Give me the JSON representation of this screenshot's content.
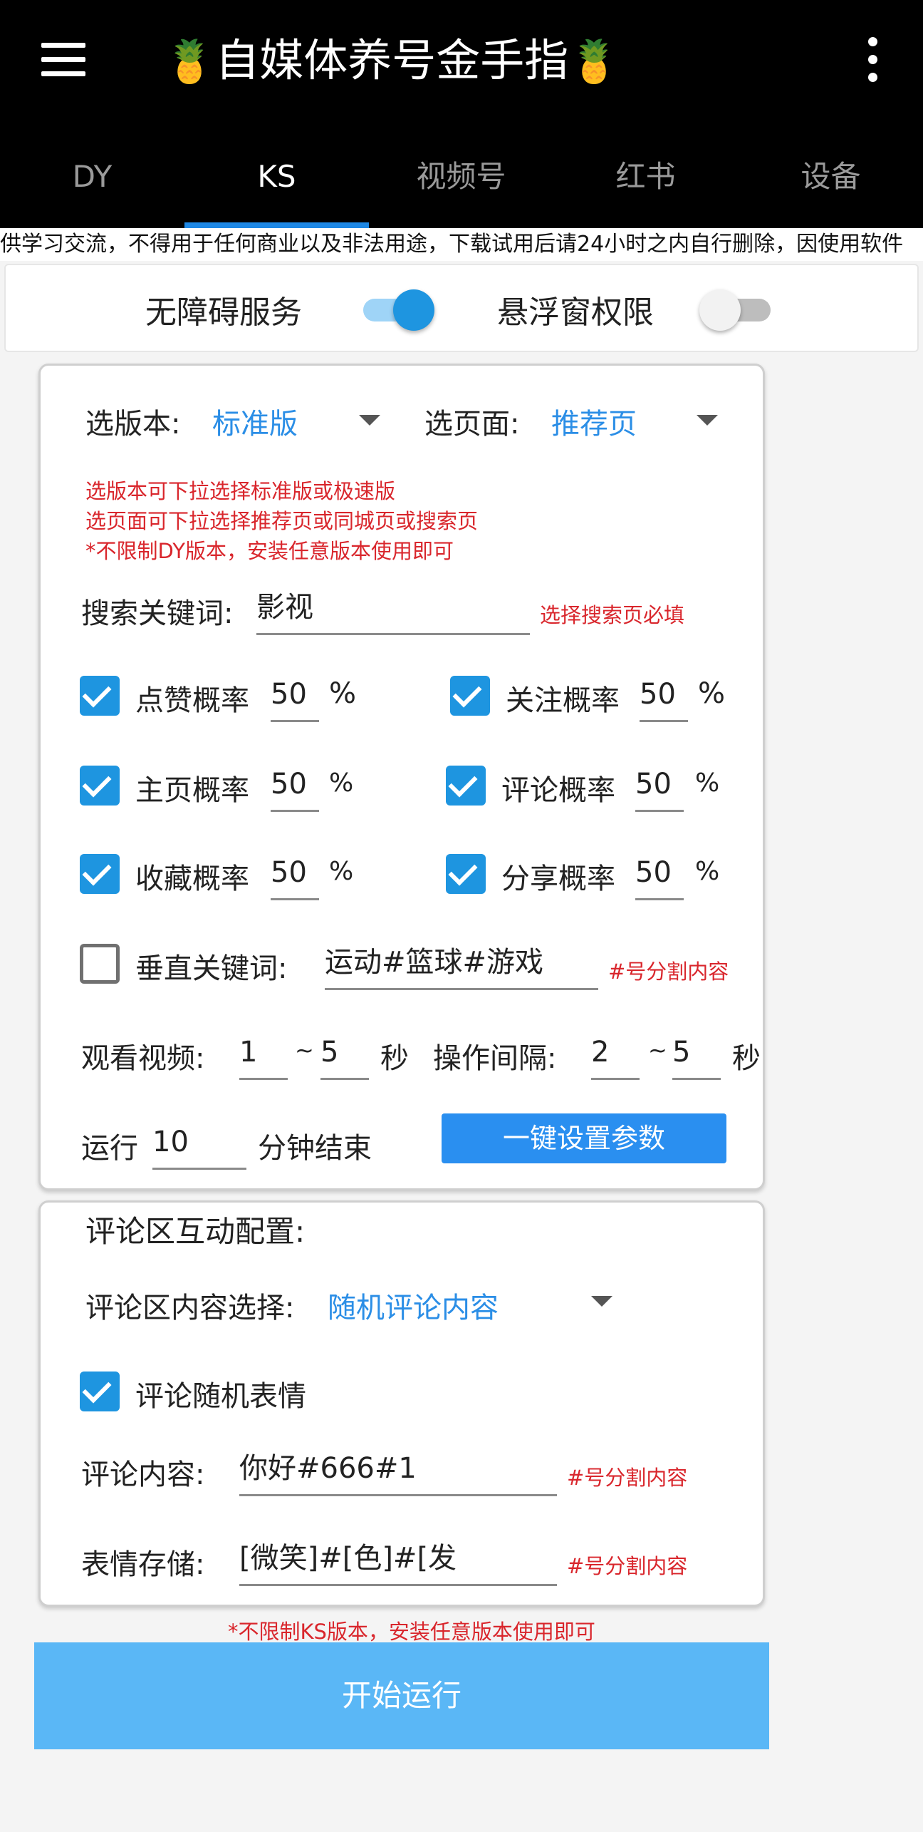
{
  "appbar": {
    "title": "自媒体养号金手指",
    "tabs": [
      "DY",
      "KS",
      "视频号",
      "红书",
      "设备"
    ],
    "active_tab": "KS"
  },
  "marquee_text": "供学习交流，不得用于任何商业以及非法用途，下载试用后请24小时之内自行删除，因使用软件",
  "permissions": {
    "accessibility_label": "无障碍服务",
    "accessibility_on": true,
    "overlay_label": "悬浮窗权限",
    "overlay_on": false
  },
  "settings": {
    "version_label": "选版本:",
    "version_value": "标准版",
    "page_label": "选页面:",
    "page_value": "推荐页",
    "notes": [
      "选版本可下拉选择标准版或极速版",
      "选页面可下拉选择推荐页或同城页或搜索页",
      "*不限制DY版本，安装任意版本使用即可"
    ],
    "search_label": "搜索关键词:",
    "search_value": "影视",
    "search_hint": "选择搜索页必填",
    "probabilities": [
      {
        "label": "点赞概率",
        "value": "50",
        "unit": "%",
        "checked": true
      },
      {
        "label": "关注概率",
        "value": "50",
        "unit": "%",
        "checked": true
      },
      {
        "label": "主页概率",
        "value": "50",
        "unit": "%",
        "checked": true
      },
      {
        "label": "评论概率",
        "value": "50",
        "unit": "%",
        "checked": true
      },
      {
        "label": "收藏概率",
        "value": "50",
        "unit": "%",
        "checked": true
      },
      {
        "label": "分享概率",
        "value": "50",
        "unit": "%",
        "checked": true
      }
    ],
    "vertical_label": "垂直关键词:",
    "vertical_value": "运动#篮球#游戏",
    "vertical_checked": false,
    "vertical_hint": "#号分割内容",
    "watch_label": "观看视频:",
    "watch_min": "1",
    "watch_max": "5",
    "watch_unit": "秒",
    "interval_label": "操作间隔:",
    "interval_min": "2",
    "interval_max": "5",
    "interval_unit": "秒",
    "tilde": "~",
    "run_prefix": "运行",
    "run_value": "10",
    "run_suffix": "分钟结束",
    "one_click_label": "一键设置参数"
  },
  "comment": {
    "section_title": "评论区互动配置:",
    "content_select_label": "评论区内容选择:",
    "content_select_value": "随机评论内容",
    "random_emoji_label": "评论随机表情",
    "random_emoji_checked": true,
    "content_label": "评论内容:",
    "content_value": "你好#666#1",
    "content_hint": "#号分割内容",
    "emoji_label": "表情存储:",
    "emoji_value": "[微笑]#[色]#[发",
    "emoji_hint": "#号分割内容"
  },
  "footer_note": "*不限制KS版本，安装任意版本使用即可",
  "start_label": "开始运行",
  "colors": {
    "accent": "#1e88e5",
    "checkbox": "#1e95e0",
    "hint_red": "#d9262c",
    "start_button": "#5ab7f6"
  }
}
